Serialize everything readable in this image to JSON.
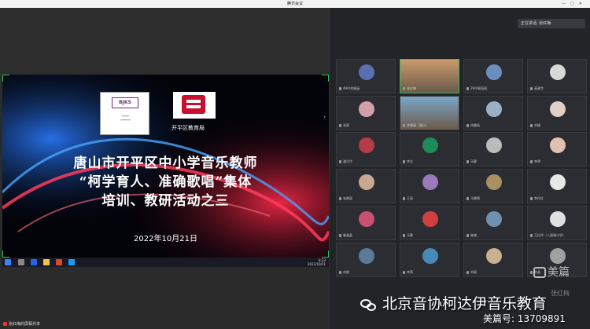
{
  "window": {
    "title": "腾讯会议"
  },
  "slide": {
    "org_label": "开平区教育局",
    "logo_mark": "BJKS",
    "title_lines": [
      "唐山市开平区中小学音乐教师",
      "“柯学育人、准确歌唱”集体",
      "培训、教研活动之三"
    ],
    "date": "2022年10月21日"
  },
  "taskbar": {
    "time": "8:33",
    "date": "2022/10/21"
  },
  "share_status": {
    "label": "张红梅的屏幕共享"
  },
  "speaker": {
    "label": "正在讲话: 张红梅"
  },
  "participants": [
    {
      "name": "49中刘婧涵",
      "color": "#5a6fb0"
    },
    {
      "name": "张红梅",
      "color": "#c99a6b",
      "video": true,
      "active": true
    },
    {
      "name": "29中郭丽丽",
      "color": "#6a8fbf"
    },
    {
      "name": "高建华",
      "color": "#d8d8d8"
    },
    {
      "name": "张丽",
      "color": "#d4a0a8"
    },
    {
      "name": "李珊珊（唐山）",
      "color": "#7aa6c8",
      "video": true
    },
    {
      "name": "徐圆扬",
      "color": "#9ab0c4"
    },
    {
      "name": "刘婧",
      "color": "#e0d0c8"
    },
    {
      "name": "潘月玲",
      "color": "#b53a4a"
    },
    {
      "name": "李艾",
      "color": "#1f8a5a"
    },
    {
      "name": "马静",
      "color": "#bbb"
    },
    {
      "name": "李明",
      "color": "#e0c0b0"
    },
    {
      "name": "张晓丽",
      "color": "#c8a890"
    },
    {
      "name": "王丽",
      "color": "#9a7ab8"
    },
    {
      "name": "马晓薇",
      "color": "#a89060"
    },
    {
      "name": "李丹红",
      "color": "#e8e8e8"
    },
    {
      "name": "鲁晶晶",
      "color": "#c85070"
    },
    {
      "name": "马静",
      "color": "#d04040"
    },
    {
      "name": "崔楠",
      "color": "#7090b0"
    },
    {
      "name": "王红玲（八面城小学）",
      "color": "#e0e0e0"
    },
    {
      "name": "刘超",
      "color": "#5a7a9a"
    },
    {
      "name": "李莉",
      "color": "#4a8ab8"
    },
    {
      "name": "刘丽",
      "color": "#c8b090"
    },
    {
      "name": "李晶",
      "color": "#a0a0a0"
    }
  ],
  "watermark": {
    "app": "美篇",
    "author": "张红梅"
  },
  "brand": {
    "name": "北京音协柯达伊音乐教育",
    "number": "美篇号: 13709891"
  }
}
